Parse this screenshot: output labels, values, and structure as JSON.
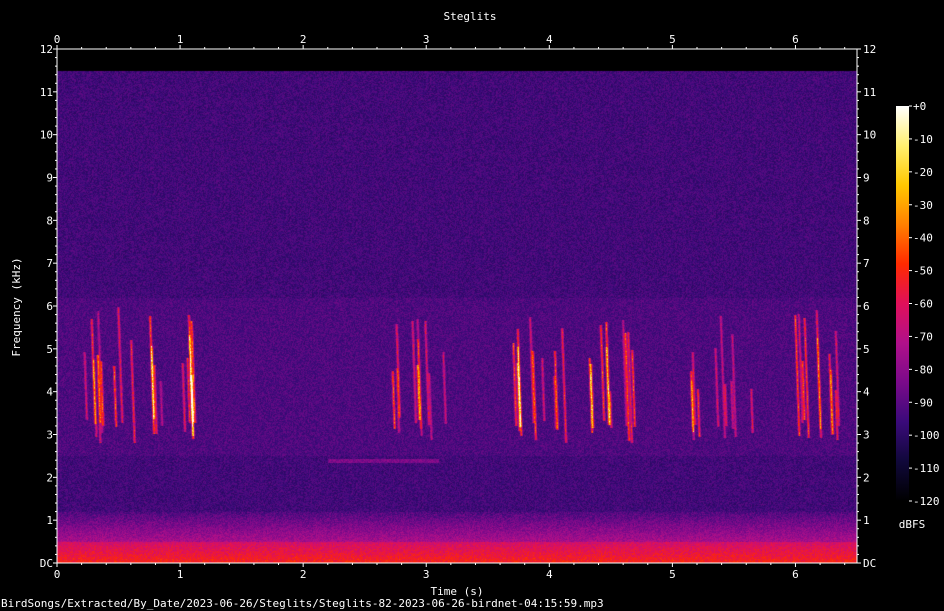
{
  "chart_data": {
    "type": "heatmap",
    "title": "Steglits",
    "xlabel": "Time (s)",
    "ylabel": "Frequency (kHz)",
    "xlim": [
      0,
      6.5
    ],
    "ylim": [
      0,
      12
    ],
    "x_ticks": [
      "0",
      "1",
      "2",
      "3",
      "4",
      "5",
      "6"
    ],
    "y_ticks": [
      "DC",
      "1",
      "2",
      "3",
      "4",
      "5",
      "6",
      "7",
      "8",
      "9",
      "10",
      "11",
      "12"
    ],
    "colorbar": {
      "label": "dBFS",
      "ticks": [
        "+0",
        "-10",
        "-20",
        "-30",
        "-40",
        "-50",
        "-60",
        "-70",
        "-80",
        "-90",
        "-100",
        "-110",
        "-120"
      ],
      "range": [
        -120,
        0
      ],
      "colors": [
        "#000000",
        "#10083a",
        "#3a0a7a",
        "#7a0a8a",
        "#b0108a",
        "#e0105a",
        "#ff2a00",
        "#ff8000",
        "#ffc800",
        "#fff070",
        "#ffffff"
      ]
    },
    "freq_cutoff_khz": 11.5
  },
  "footer": {
    "filename": "BirdSongs/Extracted/By_Date/2023-06-26/Steglits/Steglits-82-2023-06-26-birdnet-04:15:59.mp3"
  }
}
